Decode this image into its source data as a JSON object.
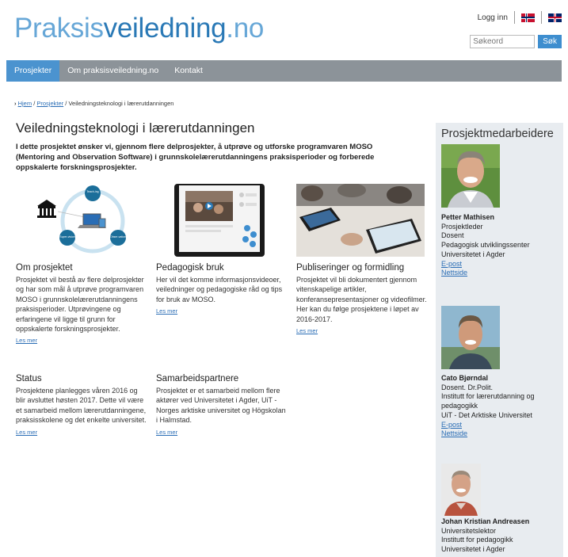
{
  "header": {
    "logo_part1": "Praksis",
    "logo_part2": "veiledning",
    "logo_part3": ".no",
    "login_label": "Logg inn",
    "search_placeholder": "Søkeord",
    "search_button": "Søk"
  },
  "nav": {
    "items": [
      {
        "label": "Prosjekter"
      },
      {
        "label": "Om praksisveiledning.no"
      },
      {
        "label": "Kontakt"
      }
    ]
  },
  "breadcrumb": {
    "sep_prefix": "›",
    "home": "Hjem",
    "projects": "Prosjekter",
    "current": "Veiledningsteknologi i lærerutdanningen",
    "slash": "/"
  },
  "main": {
    "title": "Veiledningsteknologi i lærerutdanningen",
    "intro": "I dette prosjektet ønsker vi, gjennom flere delprosjekter, å utprøve og utforske programvaren MOSO (Mentoring and Observation Software) i grunnskolelærerutdanningens praksisperioder og forberede oppskalerte forskningsprosjekter.",
    "diagram_labels": [
      "Teach-ing",
      "Super-vision",
      "Obser-vation"
    ],
    "cards": [
      {
        "title": "Om prosjektet",
        "text": "Prosjektet vil bestå av flere delprosjekter og har som mål å utprøve programvaren MOSO i grunnskolelærerutdanningens praksisperioder. Utprøvingene og erfaringene vil ligge til grunn for oppskalerte forskningsprosjekter.",
        "more": "Les mer"
      },
      {
        "title": "Pedagogisk bruk",
        "text": "Her vil det komme informasjonsvideoer, veiledninger og pedagogiske råd og tips for bruk av MOSO.",
        "more": "Les mer"
      },
      {
        "title": "Publiseringer og formidling",
        "text": "Prosjektet vil bli dokumentert gjennom vitenskapelige artikler, konferansepresentasjoner og videofilmer. Her kan du følge prosjektene i løpet av 2016-2017.",
        "more": "Les mer"
      },
      {
        "title": "Status",
        "text": "Prosjektene planlegges våren 2016 og blir avsluttet høsten 2017. Dette vil være et samarbeid mellom lærerutdanningene, praksisskolene og det enkelte universitet.",
        "more": "Les mer"
      },
      {
        "title": "Samarbeidspartnere",
        "text": "Prosjektet er et samarbeid mellom flere aktører ved Universitetet i Agder, UiT - Norges arktiske universitet og Högskolan i Halmstad.",
        "more": "Les mer"
      }
    ]
  },
  "sidebar": {
    "title": "Prosjektmedarbeidere",
    "members": [
      {
        "name": "Petter Mathisen",
        "lines": [
          "Prosjektleder",
          "Dosent",
          "Pedagogisk utviklingssenter",
          "Universitetet i Agder"
        ],
        "email": "E-post",
        "web": "Nettside"
      },
      {
        "name": "Cato Bjørndal",
        "lines": [
          "Dosent. Dr.Polit.",
          "Institutt for lærerutdanning og pedagogikk",
          "UiT - Det Arktiske Universitet"
        ],
        "email": "E-post",
        "web": "Nettside"
      },
      {
        "name": "Johan Kristian Andreasen",
        "lines": [
          "Universitetslektor",
          "Institutt for pedagogikk",
          "Universitetet i Agder"
        ]
      }
    ]
  },
  "colors": {
    "accent": "#3e8ecf",
    "nav_bg": "#8c9399",
    "sidebar_bg": "#e8ecf0"
  }
}
